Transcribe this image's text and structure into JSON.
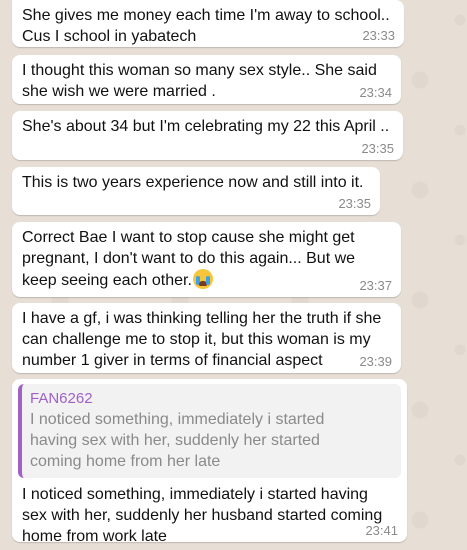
{
  "colors": {
    "wallpaper": "#e7dfd6",
    "bubble": "#ffffff",
    "timestamp": "#8a8a8a",
    "quote_accent": "#a061c7",
    "quote_background": "#f2f2f2"
  },
  "messages": [
    {
      "text": "She gives me money each time I'm away to school..\nCus I school in yabatech",
      "time": "23:33"
    },
    {
      "text": "I thought this woman so many sex style.. She said\nshe wish we were married .",
      "time": "23:34"
    },
    {
      "text": "She's about 34 but I'm celebrating my 22 this April ..",
      "time": "23:35"
    },
    {
      "text": "This is two years experience now and still into it.",
      "time": "23:35"
    },
    {
      "text": "Correct Bae I want to stop cause she might get\npregnant, I don't want to do this again... But we\nkeep seeing each other.",
      "emoji": "loudly-crying-face",
      "time": "23:37"
    },
    {
      "text": "I have a gf, i was thinking telling her the truth if she\ncan challenge me to stop it, but this woman is my\nnumber 1 giver in terms of financial aspect",
      "time": "23:39"
    },
    {
      "quote": {
        "author": "FAN6262",
        "text": "I noticed something, immediately i started\nhaving sex with her, suddenly her started\ncoming home from her late"
      },
      "text": "I noticed something, immediately i started having\nsex with her, suddenly her husband started coming\nhome from work late",
      "time": "23:41"
    }
  ]
}
